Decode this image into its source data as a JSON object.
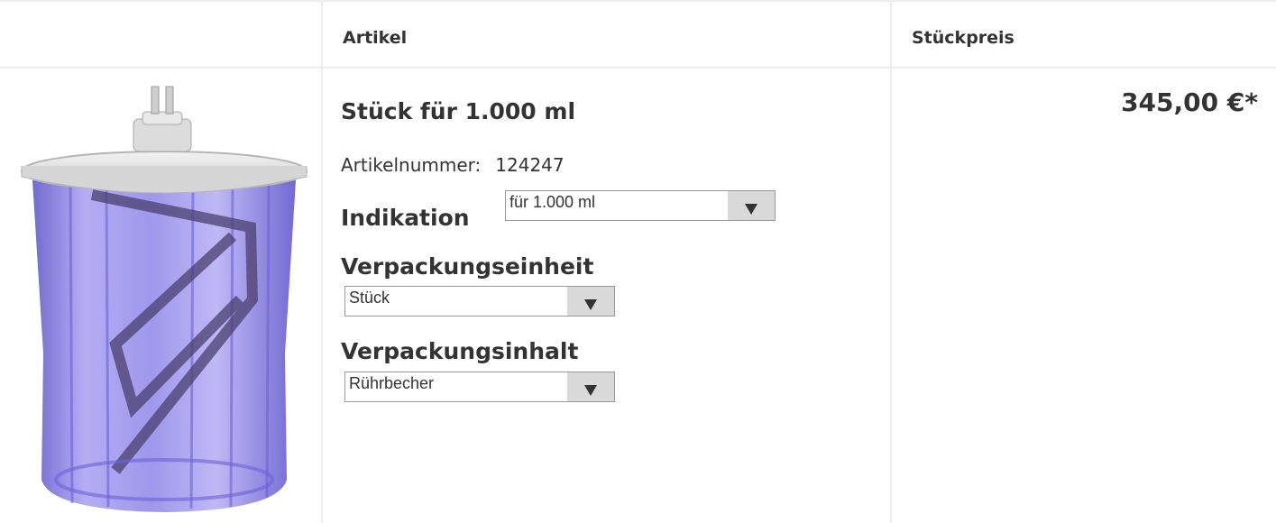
{
  "header": {
    "col_article": "Artikel",
    "col_price": "Stückpreis"
  },
  "product": {
    "title": "Stück für 1.000 ml",
    "article_number_label": "Artikelnummer:",
    "article_number": "124247",
    "price": "345,00 €*",
    "image_icon": "mixing-cup-image"
  },
  "options": {
    "indikation": {
      "label": "Indikation",
      "value": "für 1.000 ml"
    },
    "verpackungseinheit": {
      "label": "Verpackungseinheit",
      "value": "Stück"
    },
    "verpackungsinhalt": {
      "label": "Verpackungsinhalt",
      "value": "Rührbecher"
    }
  },
  "colors": {
    "text": "#333333",
    "border": "#eeeeee",
    "select_border": "#999999",
    "select_arrow_bg": "#d9d9d9",
    "cup_purple": "#7b6fd6"
  }
}
